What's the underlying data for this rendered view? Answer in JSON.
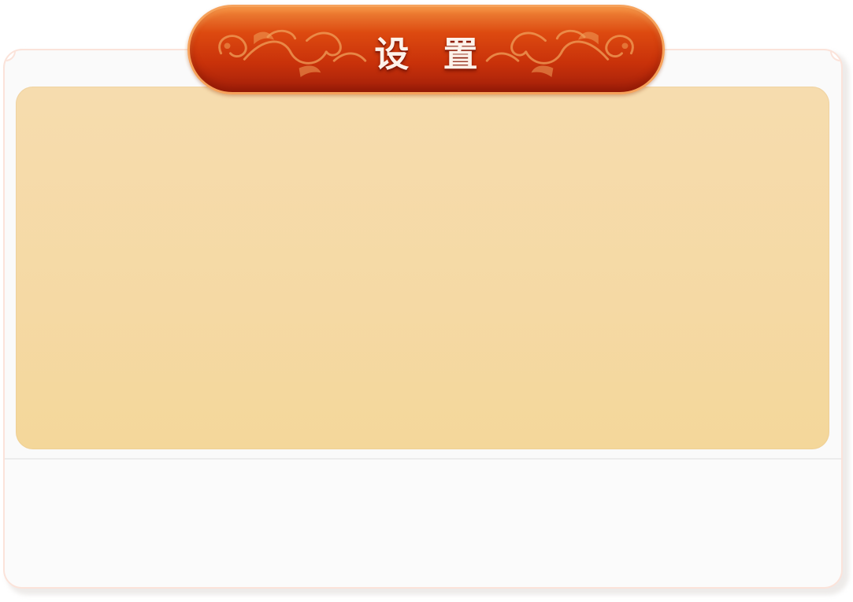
{
  "dialog": {
    "title": "设 置"
  },
  "colors": {
    "banner_top": "#dd4a10",
    "banner_bottom": "#a4200a",
    "banner_border": "#f6a25b",
    "ornament": "#f0a05a",
    "content_bg": "#f5d9a4",
    "panel_bg": "#fafafa",
    "panel_border": "#fbe3da",
    "title_text": "#fdf2ea"
  },
  "icons": {
    "banner_ornament": "floral-scroll-ornament"
  }
}
